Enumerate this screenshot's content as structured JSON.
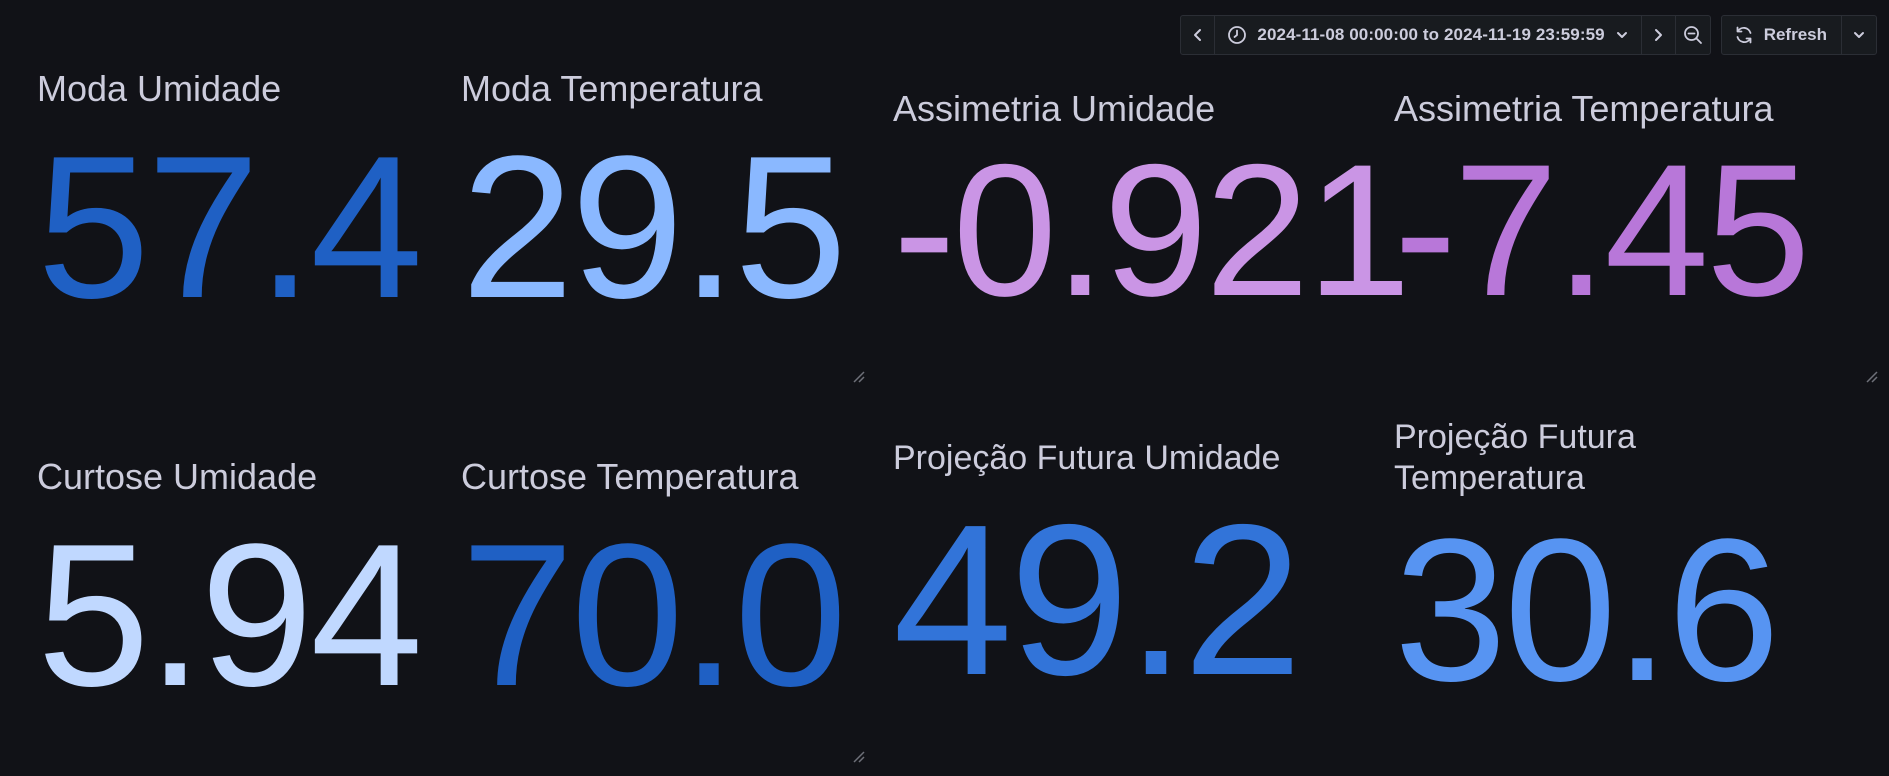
{
  "toolbar": {
    "time_range": "2024-11-08 00:00:00 to 2024-11-19 23:59:59",
    "refresh_label": "Refresh",
    "icons": [
      "chevron-left-icon",
      "clock-icon",
      "chevron-down-icon",
      "chevron-right-icon",
      "zoom-out-icon",
      "refresh-icon",
      "chevron-down-icon"
    ]
  },
  "panels": [
    {
      "title": "Moda Umidade",
      "value": "57.4",
      "color": "#1f60c4"
    },
    {
      "title": "Moda Temperatura",
      "value": "29.5",
      "color": "#8ab8ff"
    },
    {
      "title": "Assimetria Umidade",
      "value": "-0.921",
      "color": "#ca95e5"
    },
    {
      "title": "Assimetria Temperatura",
      "value": "-7.45",
      "color": "#b877d9"
    },
    {
      "title": "Curtose Umidade",
      "value": "5.94",
      "color": "#c0d8ff"
    },
    {
      "title": "Curtose Temperatura",
      "value": "70.0",
      "color": "#1f60c4"
    },
    {
      "title": "Projeção Futura Umidade",
      "value": "49.2",
      "color": "#3274d9"
    },
    {
      "title_line1": "Projeção Futura",
      "title_line2": "Temperatura",
      "value": "30.6",
      "color": "#5794f2"
    }
  ]
}
